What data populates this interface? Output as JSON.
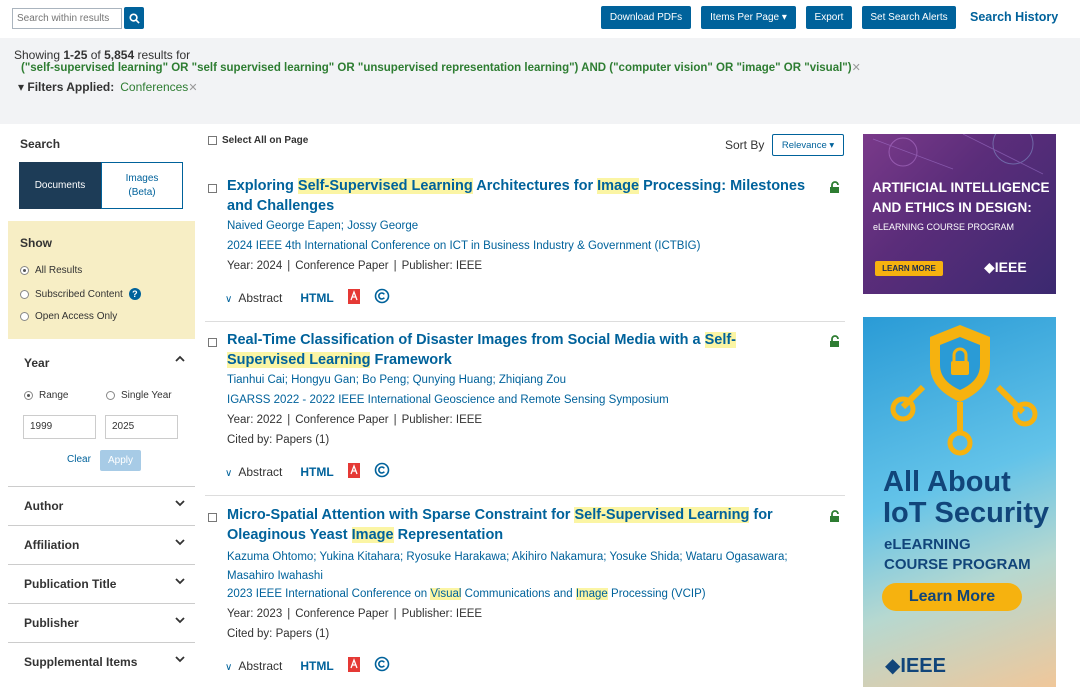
{
  "topbar": {
    "search_placeholder": "Search within results",
    "download_label": "Download PDFs",
    "items_label": "Items Per Page ▾",
    "export_label": "Export",
    "alerts_label": "Set Search Alerts",
    "history_label": "Search History"
  },
  "summary": {
    "showing_prefix": "Showing ",
    "range": "1-25",
    "of": " of ",
    "total": "5,854",
    "suffix": " results for",
    "query": "(\"self-supervised learning\" OR \"self supervised learning\" OR \"unsupervised representation learning\") AND (\"computer vision\" OR \"image\" OR \"visual\")",
    "filters_label": "▾ Filters Applied:",
    "filter_value": "Conferences"
  },
  "sidebar": {
    "search_heading": "Search",
    "tab_documents": "Documents",
    "tab_images_line1": "Images",
    "tab_images_line2": "(Beta)",
    "show_title": "Show",
    "show_options": [
      "All Results",
      "Subscribed Content",
      "Open Access Only"
    ],
    "year_title": "Year",
    "range_label": "Range",
    "single_year_label": "Single Year",
    "year_from": "1999",
    "year_to": "2025",
    "clear_label": "Clear",
    "apply_label": "Apply",
    "facets": [
      "Author",
      "Affiliation",
      "Publication Title",
      "Publisher",
      "Supplemental Items"
    ]
  },
  "results_header": {
    "select_all": "Select All on Page",
    "sort_by": "Sort By",
    "sort_value": "Relevance ▾"
  },
  "results": [
    {
      "title_parts": [
        {
          "t": "Exploring ",
          "h": false
        },
        {
          "t": "Self-Supervised Learning",
          "h": true
        },
        {
          "t": " Architectures for ",
          "h": false
        },
        {
          "t": "Image",
          "h": true
        },
        {
          "t": " Processing: Milestones and Challenges",
          "h": false
        }
      ],
      "authors": "Naived George Eapen; Jossy George",
      "conference_parts": [
        {
          "t": "2024 IEEE 4th International Conference on ICT in Business Industry & Government (ICTBIG)",
          "h": false
        }
      ],
      "year": "Year: 2024",
      "type": "Conference Paper",
      "publisher": "Publisher:  IEEE",
      "cited": "",
      "abstract_label": "Abstract",
      "html_label": "HTML"
    },
    {
      "title_parts": [
        {
          "t": "Real-Time Classification of Disaster Images from Social Media with a ",
          "h": false
        },
        {
          "t": "Self-Supervised Learning",
          "h": true
        },
        {
          "t": " Framework",
          "h": false
        }
      ],
      "authors": "Tianhui Cai; Hongyu Gan; Bo Peng; Qunying Huang; Zhiqiang Zou",
      "conference_parts": [
        {
          "t": "IGARSS 2022 - 2022 IEEE International Geoscience and Remote Sensing Symposium",
          "h": false
        }
      ],
      "year": "Year: 2022",
      "type": "Conference Paper",
      "publisher": "Publisher:  IEEE",
      "cited": "Cited by: Papers (1)",
      "abstract_label": "Abstract",
      "html_label": "HTML"
    },
    {
      "title_parts": [
        {
          "t": "Micro-Spatial Attention with Sparse Constraint for ",
          "h": false
        },
        {
          "t": "Self-Supervised Learning",
          "h": true
        },
        {
          "t": " for Oleaginous Yeast ",
          "h": false
        },
        {
          "t": "Image",
          "h": true
        },
        {
          "t": " Representation",
          "h": false
        }
      ],
      "authors": "Kazuma Ohtomo; Yukina Kitahara; Ryosuke Harakawa; Akihiro Nakamura; Yosuke Shida; Wataru Ogasawara; Masahiro Iwahashi",
      "conference_parts": [
        {
          "t": "2023 IEEE International Conference on ",
          "h": false
        },
        {
          "t": "Visual",
          "h": true
        },
        {
          "t": " Communications and ",
          "h": false
        },
        {
          "t": "Image",
          "h": true
        },
        {
          "t": " Processing (VCIP)",
          "h": false
        }
      ],
      "year": "Year: 2023",
      "type": "Conference Paper",
      "publisher": "Publisher:  IEEE",
      "cited": "Cited by: Papers (1)",
      "abstract_label": "Abstract",
      "html_label": "HTML"
    }
  ],
  "ads": {
    "ad1_line1": "ARTIFICIAL INTELLIGENCE",
    "ad1_line2": "AND ETHICS IN DESIGN:",
    "ad1_sub": "eLEARNING COURSE PROGRAM",
    "ad1_button": "LEARN MORE",
    "ad1_logo": "◆IEEE",
    "ad2_line1": "All About",
    "ad2_line2": "IoT Security",
    "ad2_sub1": "eLEARNING",
    "ad2_sub2": "COURSE PROGRAM",
    "ad2_button": "Learn More",
    "ad2_logo": "◆IEEE"
  },
  "colors": {
    "brand_blue": "#00629b",
    "highlight": "#fbf5a4",
    "query_green": "#2e7d32",
    "show_panel": "#f7eec5",
    "lock_green": "#2e7d32",
    "pdf_red": "#e53935"
  }
}
